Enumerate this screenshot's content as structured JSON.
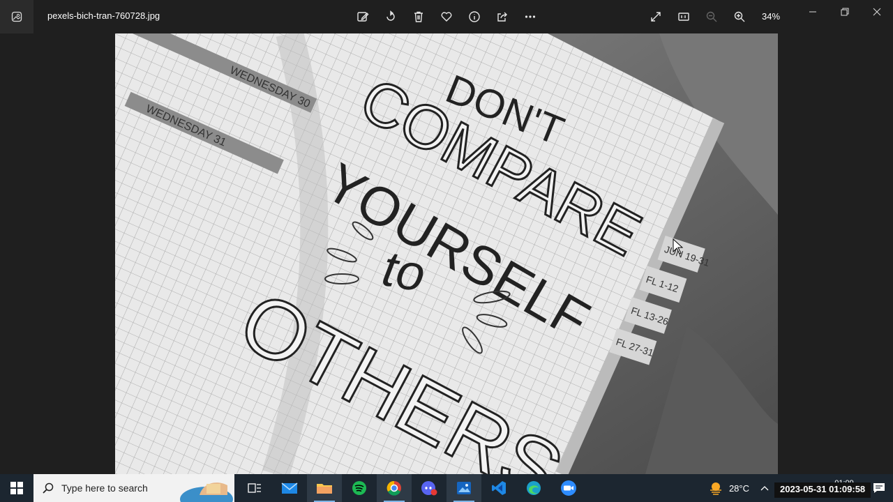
{
  "window": {
    "file_name": "pexels-bich-tran-760728.jpg",
    "zoom": "34%"
  },
  "toolbar": {
    "items": [
      "edit-image-icon",
      "rotate-icon",
      "delete-icon",
      "favorite-icon",
      "info-icon",
      "share-icon",
      "more-icon"
    ]
  },
  "right_tools": [
    "fullscreen-icon",
    "actual-size-icon",
    "zoom-out-icon",
    "zoom-in-icon"
  ],
  "photo": {
    "lines": [
      "DON'T",
      "COMPARE",
      "YOURSELF",
      "to",
      "OTHERS"
    ],
    "planner_labels": [
      "WEDNESDAY 30",
      "WEDNESDAY 31"
    ],
    "tabs": [
      "JUN 19-31",
      "FL 1-12",
      "FL 13-26",
      "FL 27-31"
    ]
  },
  "taskbar": {
    "search_placeholder": "Type here to search",
    "apps": [
      "task-view-icon",
      "mail-icon",
      "file-explorer-icon",
      "spotify-icon",
      "chrome-icon",
      "discord-icon",
      "photos-icon",
      "vscode-icon",
      "edge-icon",
      "zoom-icon"
    ],
    "weather": "28°C",
    "clock_time": "01:09",
    "clock_date": "31-05-2023",
    "overlay_timestamp": "2023-05-31 01:09:58"
  }
}
